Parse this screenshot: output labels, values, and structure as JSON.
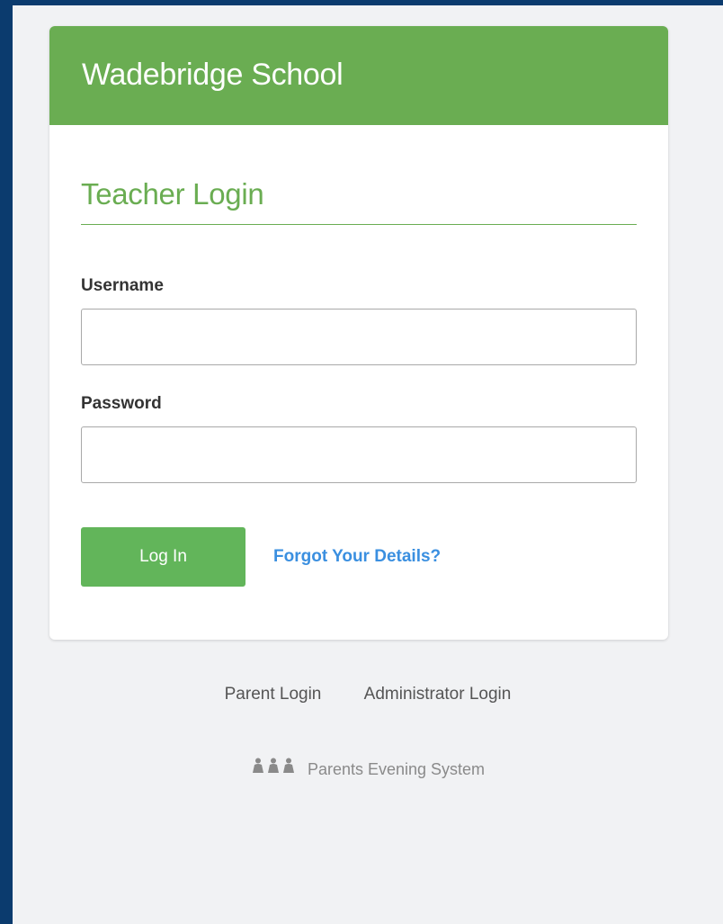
{
  "header": {
    "school_name": "Wadebridge School"
  },
  "login": {
    "title": "Teacher Login",
    "username_label": "Username",
    "username_value": "",
    "password_label": "Password",
    "password_value": "",
    "submit_label": "Log In",
    "forgot_label": "Forgot Your Details?"
  },
  "footer": {
    "links": [
      {
        "label": "Parent Login"
      },
      {
        "label": "Administrator Login"
      }
    ],
    "brand_icon": "people-group-icon",
    "brand_text": "Parents Evening System"
  },
  "colors": {
    "frame": "#0b3b6e",
    "page_background": "#f1f2f4",
    "accent_green": "#6aad52",
    "button_green": "#62b55a",
    "link_blue": "#3a8fe0"
  }
}
